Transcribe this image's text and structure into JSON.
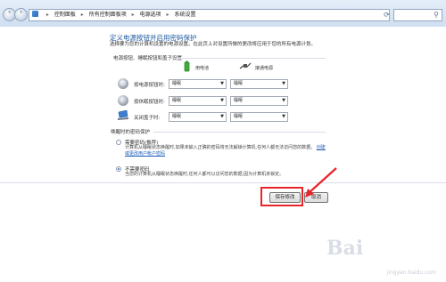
{
  "window": {
    "breadcrumb": [
      "控制面板",
      "所有控制面板项",
      "电源选项",
      "系统设置"
    ],
    "search_placeholder": ""
  },
  "page": {
    "title": "定义电源按钮并启用密码保护",
    "intro": "选择要为您的计算机设置的电源设置。在此页上对设置所做的更改将应用于您的所有电源计划。"
  },
  "power_buttons": {
    "heading": "电源按钮、睡眠按钮和盖子设置",
    "columns": [
      "用电池",
      "接通电源"
    ],
    "rows": [
      {
        "label": "按电源按钮时:",
        "battery": "睡眠",
        "plugged": "睡眠",
        "icon": "power-icon"
      },
      {
        "label": "按休眠按钮时:",
        "battery": "睡眠",
        "plugged": "睡眠",
        "icon": "sleep-icon"
      },
      {
        "label": "关闭盖子时:",
        "battery": "睡眠",
        "plugged": "睡眠",
        "icon": "lid-icon"
      }
    ]
  },
  "wake_password": {
    "heading": "唤醒时的密码保护",
    "options": [
      {
        "title": "需要密码(推荐)",
        "desc": "计算机从睡眠状态唤醒时,如果未输入正确的密码将无法解锁计算机,任何人都无法访问您的数据。",
        "link": "创建或更改用户帐户密码",
        "selected": false
      },
      {
        "title": "不需要密码",
        "desc": "当您的计算机从睡眠状态唤醒时,任何人都可以访问您的数据,因为计算机未锁定。",
        "link": "",
        "selected": true
      }
    ]
  },
  "footer": {
    "save": "保存修改",
    "cancel": "取消"
  },
  "watermark": {
    "logo": "Bai",
    "text": "jingyan.baidu.com"
  },
  "colors": {
    "highlight": "#e8242b",
    "title": "#1e5aa0",
    "link": "#1a5cb8"
  }
}
